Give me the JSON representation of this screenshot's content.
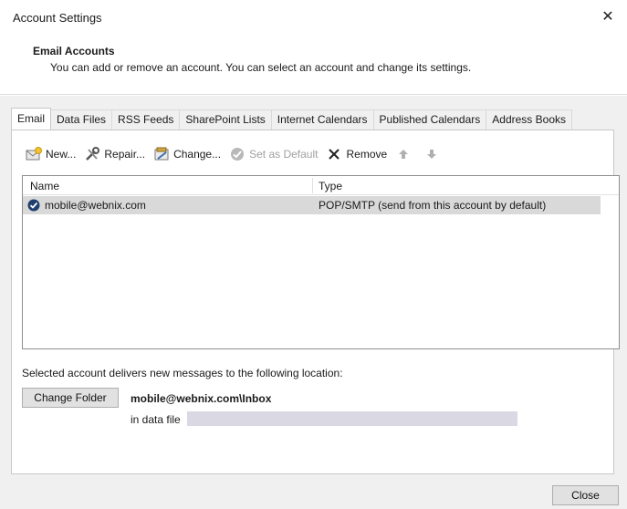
{
  "window": {
    "title": "Account Settings",
    "close_glyph": "✕"
  },
  "header": {
    "title": "Email Accounts",
    "description": "You can add or remove an account. You can select an account and change its settings."
  },
  "tabs": [
    {
      "label": "Email",
      "active": true
    },
    {
      "label": "Data Files"
    },
    {
      "label": "RSS Feeds"
    },
    {
      "label": "SharePoint Lists"
    },
    {
      "label": "Internet Calendars"
    },
    {
      "label": "Published Calendars"
    },
    {
      "label": "Address Books"
    }
  ],
  "toolbar": {
    "new_label": "New...",
    "repair_label": "Repair...",
    "change_label": "Change...",
    "set_default_label": "Set as Default",
    "remove_label": "Remove"
  },
  "accounts_list": {
    "columns": {
      "name": "Name",
      "type": "Type"
    },
    "rows": [
      {
        "name": "mobile@webnix.com",
        "type": "POP/SMTP (send from this account by default)"
      }
    ]
  },
  "delivery": {
    "text": "Selected account delivers new messages to the following location:",
    "change_folder_label": "Change Folder",
    "folder_path": "mobile@webnix.com\\Inbox",
    "data_file_label": "in data file"
  },
  "footer": {
    "close_label": "Close"
  },
  "colors": {
    "selected_row": "#d9d9d9",
    "dialog_bg": "#f0f0f0",
    "accent": "#1f4e96"
  }
}
